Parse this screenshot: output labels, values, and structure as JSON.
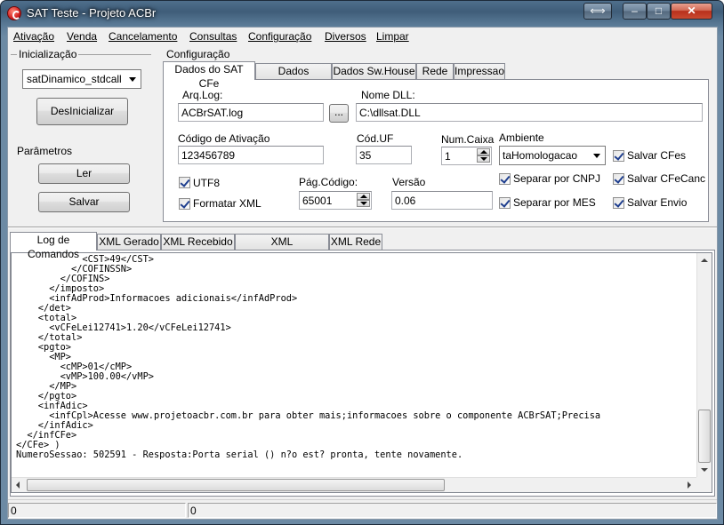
{
  "window": {
    "title": "SAT Teste - Projeto ACBr",
    "restore_glyph": "⟺",
    "min_glyph": "–",
    "max_glyph": "□",
    "close_glyph": "✕"
  },
  "menu": [
    "Ativação",
    "Venda",
    "Cancelamento",
    "Consultas",
    "Configuração",
    "Diversos",
    "Limpar"
  ],
  "init": {
    "group_label": "Inicialização",
    "library": "satDinamico_stdcall",
    "deinit_button": "DesInicializar"
  },
  "params": {
    "group_label": "Parâmetros",
    "read_button": "Ler",
    "save_button": "Salvar"
  },
  "config": {
    "group_label": "Configuração",
    "tabs": [
      "Dados do SAT CFe",
      "Dados Emitente",
      "Dados Sw.House",
      "Rede",
      "Impressao"
    ],
    "arq_log_label": "Arq.Log:",
    "arq_log": "ACBrSAT.log",
    "browse": "...",
    "dll_label": "Nome DLL:",
    "dll": "C:\\dllsat.DLL",
    "codigo_ativacao_label": "Código de Ativação",
    "codigo_ativacao": "123456789",
    "cod_uf_label": "Cód.UF",
    "cod_uf": "35",
    "num_caixa_label": "Num.Caixa",
    "num_caixa": "1",
    "ambiente_label": "Ambiente",
    "ambiente": "taHomologacao",
    "utf8_label": "UTF8",
    "formatar_xml_label": "Formatar XML",
    "pag_codigo_label": "Pág.Código:",
    "pag_codigo": "65001",
    "versao_label": "Versão",
    "versao": "0.06",
    "salvar_cfes_label": "Salvar CFes",
    "separar_cnpj_label": "Separar por CNPJ",
    "salvar_cfecanc_label": "Salvar CFeCanc",
    "separar_mes_label": "Separar por MES",
    "salvar_envio_label": "Salvar Envio"
  },
  "log_tabs": [
    "Log de Comandos",
    "XML Gerado",
    "XML Recebido",
    "XML Cancelamento",
    "XML Rede"
  ],
  "log_lines": [
    "            <CST>49</CST>",
    "          </COFINSSN>",
    "        </COFINS>",
    "      </imposto>",
    "      <infAdProd>Informacoes adicionais</infAdProd>",
    "    </det>",
    "    <total>",
    "      <vCFeLei12741>1.20</vCFeLei12741>",
    "    </total>",
    "    <pgto>",
    "      <MP>",
    "        <cMP>01</cMP>",
    "        <vMP>100.00</vMP>",
    "      </MP>",
    "    </pgto>",
    "    <infAdic>",
    "      <infCpl>Acesse www.projetoacbr.com.br para obter mais;informacoes sobre o componente ACBrSAT;Precisa",
    "    </infAdic>",
    "  </infCFe>",
    "</CFe> )",
    "NumeroSessao: 502591 - Resposta:Porta serial () n?o est? pronta, tente novamente."
  ],
  "status": {
    "left": "0",
    "right": "0"
  }
}
